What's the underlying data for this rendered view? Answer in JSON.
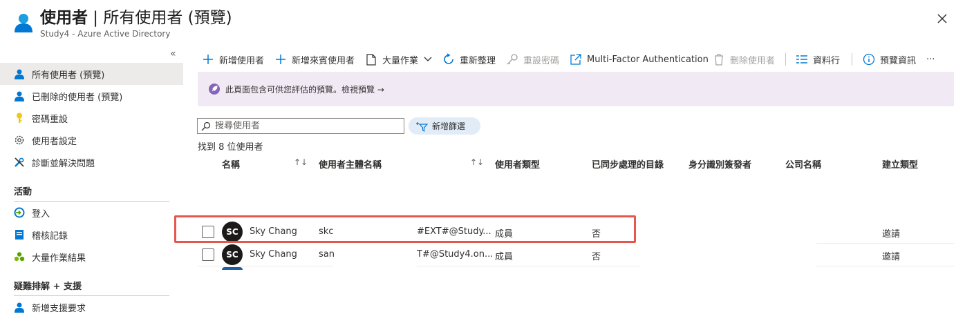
{
  "header": {
    "title_bold": "使用者",
    "title_rest": " | 所有使用者 (預覽)",
    "subtitle": "Study4 - Azure Active Directory",
    "collapse_glyph": "«",
    "close_icon": "close-icon"
  },
  "sidebar": {
    "items": [
      {
        "label": "所有使用者 (預覽)",
        "icon": "user-icon"
      },
      {
        "label": "已刪除的使用者 (預覽)",
        "icon": "user-icon"
      },
      {
        "label": "密碼重設",
        "icon": "key-icon"
      },
      {
        "label": "使用者設定",
        "icon": "gear-icon"
      },
      {
        "label": "診斷並解決問題",
        "icon": "wrench-icon"
      }
    ],
    "section_activity": "活動",
    "activity_items": [
      {
        "label": "登入",
        "icon": "sign-in-icon"
      },
      {
        "label": "稽核記錄",
        "icon": "audit-log-icon"
      },
      {
        "label": "大量作業結果",
        "icon": "bulk-results-icon"
      }
    ],
    "section_support": "疑難排解 + 支援",
    "support_items": [
      {
        "label": "新增支援要求",
        "icon": "support-user-icon"
      }
    ]
  },
  "toolbar": {
    "new_user": "新增使用者",
    "new_guest": "新增來賓使用者",
    "bulk_ops": "大量作業",
    "refresh": "重新整理",
    "reset_password": "重設密碼",
    "mfa": "Multi-Factor Authentication",
    "delete_user": "刪除使用者",
    "columns": "資料行",
    "preview_info": "預覽資訊",
    "more": "···"
  },
  "banner": {
    "text": "此頁面包含可供您評估的預覽。",
    "link": "檢視預覽 →"
  },
  "search": {
    "placeholder": "搜尋使用者",
    "value": ""
  },
  "filter_button": "新增篩選",
  "result_count": "找到 8 位使用者",
  "table": {
    "columns": [
      "名稱",
      "使用者主體名稱",
      "使用者類型",
      "已同步處理的目錄",
      "身分識別簽發者",
      "公司名稱",
      "建立類型"
    ],
    "sort_glyph": "↑↓",
    "rows": [
      {
        "initials": "SC",
        "name": "Sky Chang",
        "upn_start": "skc",
        "upn_end": "#EXT#@Study...",
        "user_type": "成員",
        "synced": "否",
        "creation_type": "邀請"
      },
      {
        "initials": "SC",
        "name": "Sky Chang",
        "upn_start": "san",
        "upn_end": "T#@Study4.on...",
        "user_type": "成員",
        "synced": "否",
        "creation_type": "邀請"
      }
    ]
  },
  "colors": {
    "accent": "#0078d4",
    "highlight": "#e8554b",
    "banner_bg": "#f1eaf5",
    "selected_nav": "#edebe9"
  }
}
